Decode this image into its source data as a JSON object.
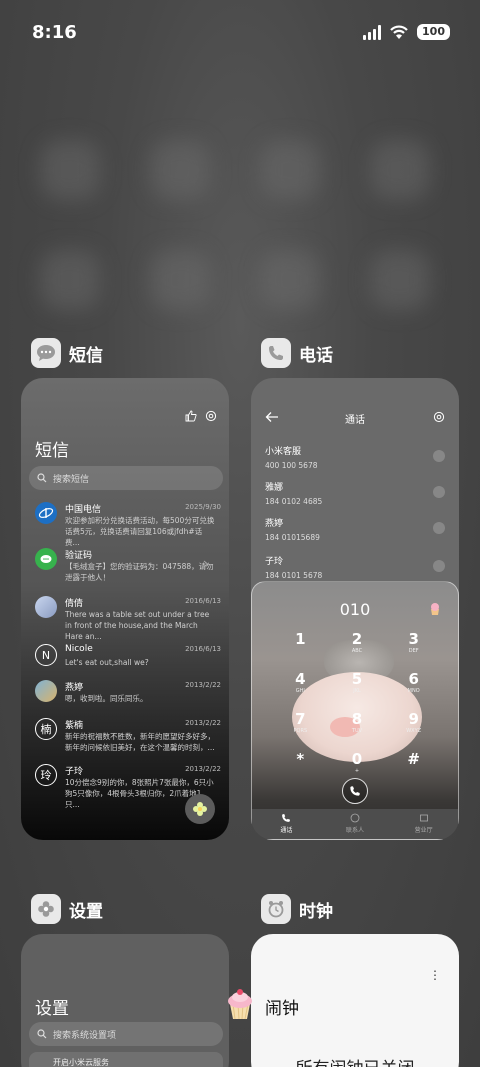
{
  "status_bar": {
    "time": "8:16",
    "battery": "100"
  },
  "apps": {
    "sms": {
      "label": "短信",
      "heading": "短信",
      "search_placeholder": "搜索短信",
      "messages": [
        {
          "name": "中国电信",
          "date": "2025/9/30",
          "preview": "欢迎参加积分兑换话费活动，每500分可兑换话费5元，兑换话费请回复106或jfdh#话费..."
        },
        {
          "name": "验证码",
          "date": "",
          "preview": "【毛绒盒子】您的验证码为：047588，请勿泄露于他人！"
        },
        {
          "name": "倩倩",
          "date": "2016/6/13",
          "preview": "There was a table set out under a tree in front of the house,and the March Hare an..."
        },
        {
          "name": "Nicole",
          "date": "2016/6/13",
          "preview": "Let's eat out,shall we?"
        },
        {
          "name": "燕婷",
          "date": "2013/2/22",
          "preview": "嗯，收到啦。同乐同乐。"
        },
        {
          "name": "紫楠",
          "date": "2013/2/22",
          "preview": "新年的祝福数不胜数，新年的愿望好多好多，新年的问候依旧美好，在这个温馨的时刻，..."
        },
        {
          "name": "子玲",
          "date": "2013/2/22",
          "preview": "10分偿念9别的你，8张照片7张最你，6只小狗5只像你，4根骨头3根归你，2爪着地1只..."
        }
      ]
    },
    "phone": {
      "label": "电话",
      "title": "通话",
      "contacts": [
        {
          "name": "小米客服",
          "number": "400 100 5678"
        },
        {
          "name": "雅娜",
          "number": "184 0102 4685"
        },
        {
          "name": "燕婷",
          "number": "184 01015689"
        },
        {
          "name": "子玲",
          "number": "184 0101 5678"
        }
      ],
      "dial_input": "010",
      "keys": [
        {
          "k": "1",
          "l": ""
        },
        {
          "k": "2",
          "l": "ABC"
        },
        {
          "k": "3",
          "l": "DEF"
        },
        {
          "k": "4",
          "l": "GHI"
        },
        {
          "k": "5",
          "l": "JKL"
        },
        {
          "k": "6",
          "l": "MNO"
        },
        {
          "k": "7",
          "l": "PQRS"
        },
        {
          "k": "8",
          "l": "TUV"
        },
        {
          "k": "9",
          "l": "WXYZ"
        },
        {
          "k": "*",
          "l": ""
        },
        {
          "k": "0",
          "l": "+"
        },
        {
          "k": "#",
          "l": ""
        }
      ],
      "tabs": [
        "通话",
        "联系人",
        "营业厅"
      ]
    },
    "settings": {
      "label": "设置",
      "heading": "设置",
      "search_placeholder": "搜索系统设置项",
      "row": "开启小米云服务"
    },
    "clock": {
      "label": "时钟",
      "heading": "闹钟",
      "status": "所有闹钟已关闭"
    }
  }
}
